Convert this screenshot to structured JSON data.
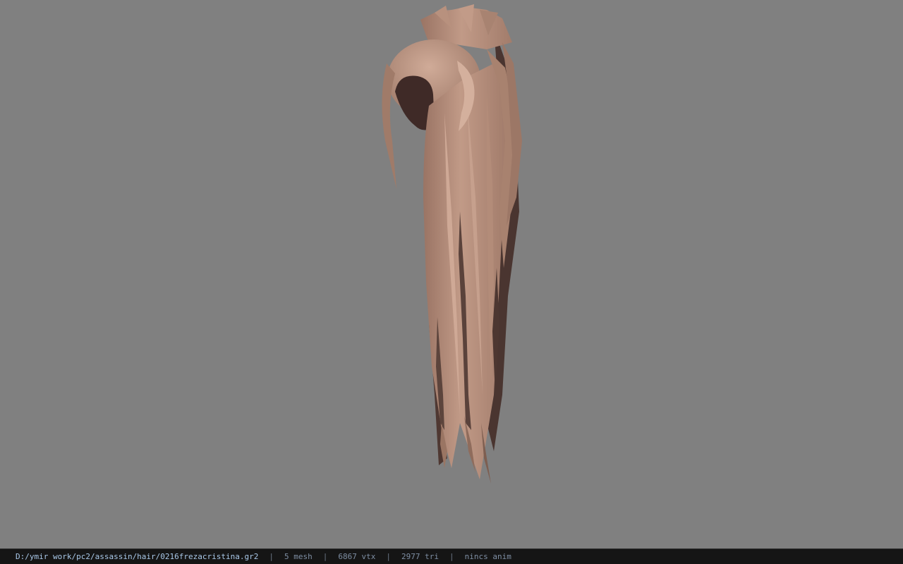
{
  "viewport": {
    "background_color": "#808080",
    "model": {
      "description": "hair mesh preview",
      "hair_color": "#b28b78",
      "hair_shadow_color": "#4a3530"
    }
  },
  "status_bar": {
    "file_path": "D:/ymir work/pc2/assassin/hair/0216frezacristina.gr2",
    "separator": "|",
    "mesh_count": "5 mesh",
    "vertex_count": "6867 vtx",
    "triangle_count": "2977 tri",
    "anim_status": "nincs anim"
  }
}
